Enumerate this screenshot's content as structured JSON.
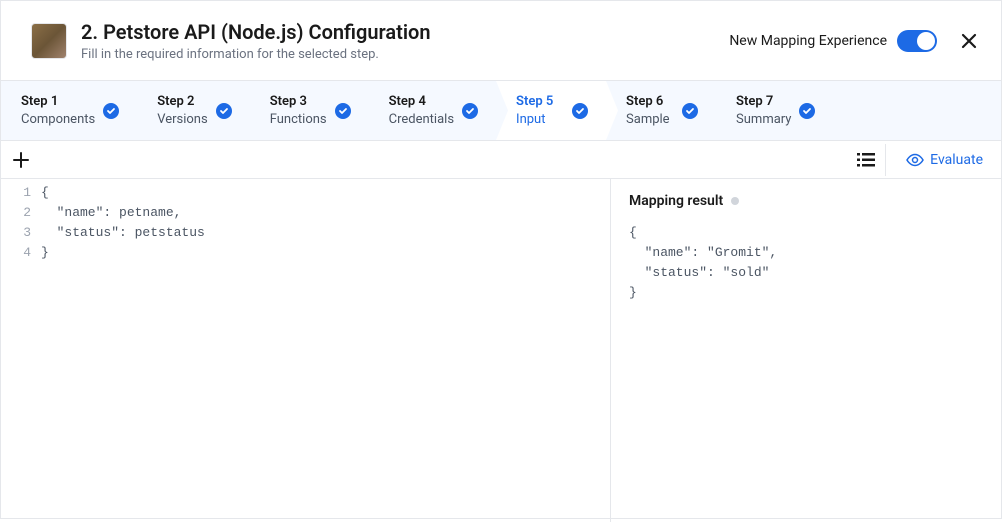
{
  "header": {
    "title": "2. Petstore API (Node.js) Configuration",
    "subtitle": "Fill in the required information for the selected step.",
    "toggle_label": "New Mapping Experience",
    "toggle_on": true
  },
  "stepper": {
    "active_index": 4,
    "steps": [
      {
        "title": "Step 1",
        "sub": "Components",
        "done": true
      },
      {
        "title": "Step 2",
        "sub": "Versions",
        "done": true
      },
      {
        "title": "Step 3",
        "sub": "Functions",
        "done": true
      },
      {
        "title": "Step 4",
        "sub": "Credentials",
        "done": true
      },
      {
        "title": "Step 5",
        "sub": "Input",
        "done": true
      },
      {
        "title": "Step 6",
        "sub": "Sample",
        "done": true
      },
      {
        "title": "Step 7",
        "sub": "Summary",
        "done": true
      }
    ]
  },
  "toolbar": {
    "evaluate_label": "Evaluate"
  },
  "editor": {
    "lines": [
      "{",
      "  \"name\": petname,",
      "  \"status\": petstatus",
      "}"
    ]
  },
  "result": {
    "title": "Mapping result",
    "body": "{\n  \"name\": \"Gromit\",\n  \"status\": \"sold\"\n}"
  }
}
